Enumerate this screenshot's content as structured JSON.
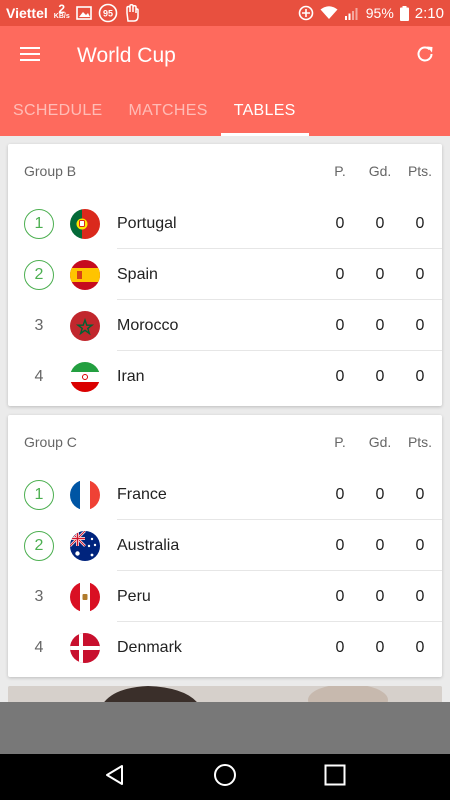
{
  "status_bar": {
    "carrier": "Viettel",
    "speed_value": "2",
    "speed_unit": "KB/s",
    "notif_badge": "95",
    "battery": "95%",
    "time": "2:10"
  },
  "app_bar": {
    "title": "World Cup",
    "tabs": [
      {
        "label": "SCHEDULE",
        "active": false
      },
      {
        "label": "MATCHES",
        "active": false
      },
      {
        "label": "TABLES",
        "active": true
      }
    ]
  },
  "groups": [
    {
      "name": "Group B",
      "col_p": "P.",
      "col_gd": "Gd.",
      "col_pts": "Pts.",
      "teams": [
        {
          "pos": "1",
          "name": "Portugal",
          "p": "0",
          "gd": "0",
          "pts": "0"
        },
        {
          "pos": "2",
          "name": "Spain",
          "p": "0",
          "gd": "0",
          "pts": "0"
        },
        {
          "pos": "3",
          "name": "Morocco",
          "p": "0",
          "gd": "0",
          "pts": "0"
        },
        {
          "pos": "4",
          "name": "Iran",
          "p": "0",
          "gd": "0",
          "pts": "0"
        }
      ]
    },
    {
      "name": "Group C",
      "col_p": "P.",
      "col_gd": "Gd.",
      "col_pts": "Pts.",
      "teams": [
        {
          "pos": "1",
          "name": "France",
          "p": "0",
          "gd": "0",
          "pts": "0"
        },
        {
          "pos": "2",
          "name": "Australia",
          "p": "0",
          "gd": "0",
          "pts": "0"
        },
        {
          "pos": "3",
          "name": "Peru",
          "p": "0",
          "gd": "0",
          "pts": "0"
        },
        {
          "pos": "4",
          "name": "Denmark",
          "p": "0",
          "gd": "0",
          "pts": "0"
        }
      ]
    }
  ],
  "colors": {
    "status_bar": "#e8503f",
    "app_bar": "#fe6a5d",
    "qualify": "#4caf50"
  }
}
